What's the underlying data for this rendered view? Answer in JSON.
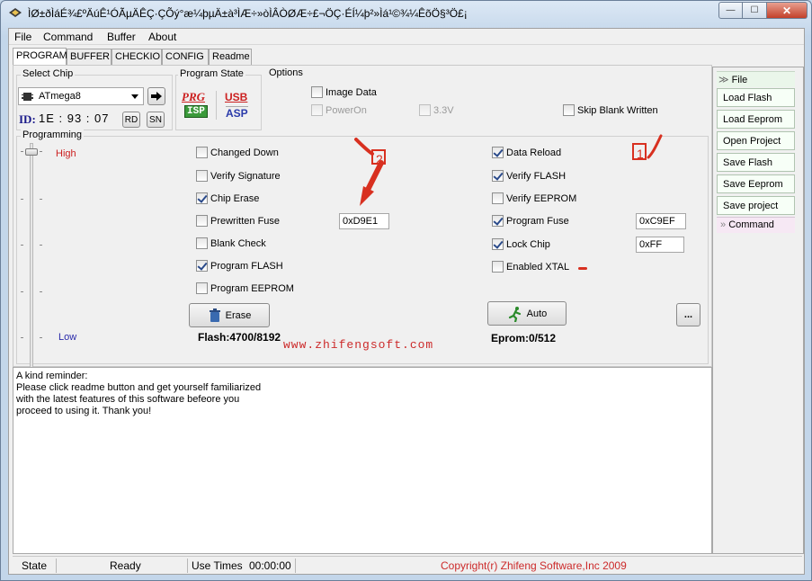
{
  "window": {
    "title": "ÌØ±ðÌáÉ¾£ºÄúÊ¹ÓÃµÄÊÇ·ÇÕý°æ¼þµÄ±à³ÌÆ÷»òÌÂÒØÆ÷£¬ÖÇ·ÉÍ¼þ²»Ìá¹©¾¼ÊõÖ§³Ö£¡",
    "minimize": "—",
    "maximize": "☐",
    "close": "✕"
  },
  "menu": [
    "File",
    "Command",
    "Buffer",
    "About"
  ],
  "tabs": [
    "PROGRAM",
    "BUFFER",
    "CHECKIO",
    "CONFIG",
    "Readme"
  ],
  "select_chip": {
    "label": "Select Chip",
    "value": "ATmega8",
    "id_label": "ID:",
    "id_value": "1E : 93 : 07",
    "rd": "RD",
    "sn": "SN"
  },
  "program_state": {
    "label": "Program State",
    "prg": "PRG",
    "isp": "ISP",
    "usb": "USB",
    "asp": "ASP"
  },
  "options": {
    "label": "Options",
    "image_data": "Image Data",
    "power_on": "PowerOn",
    "v33": "3.3V",
    "skip_blank": "Skip Blank Written"
  },
  "programming": {
    "label": "Programming",
    "high": "High",
    "low": "Low",
    "left_checks": [
      {
        "label": "Changed Down",
        "checked": false
      },
      {
        "label": "Verify Signature",
        "checked": false
      },
      {
        "label": "Chip Erase",
        "checked": true
      },
      {
        "label": "Prewritten Fuse",
        "checked": false
      },
      {
        "label": "Blank Check",
        "checked": false
      },
      {
        "label": "Program FLASH",
        "checked": true
      },
      {
        "label": "Program EEPROM",
        "checked": false
      }
    ],
    "right_checks": [
      {
        "label": "Data Reload",
        "checked": true
      },
      {
        "label": "Verify FLASH",
        "checked": true
      },
      {
        "label": "Verify EEPROM",
        "checked": false
      },
      {
        "label": "Program Fuse",
        "checked": true
      },
      {
        "label": "Lock Chip",
        "checked": true
      },
      {
        "label": "Enabled XTAL",
        "checked": false
      }
    ],
    "prewritten_fuse_value": "0xD9E1",
    "program_fuse_value": "0xC9EF",
    "lock_chip_value": "0xFF",
    "erase": "Erase",
    "auto": "Auto",
    "more": "...",
    "flash": "Flash:4700/8192",
    "eprom": "Eprom:0/512",
    "watermark": "www.zhifengsoft.com",
    "annotation_1": "1",
    "annotation_2": "2"
  },
  "reminder": {
    "lines": [
      "A kind reminder:",
      "Please click readme button and get yourself familiarized",
      "with the latest features of this software befeore you",
      "proceed to using it. Thank you!"
    ]
  },
  "status": {
    "state_label": "State",
    "state_value": "Ready",
    "use_times_label": "Use Times",
    "use_times_value": "00:00:00",
    "copyright": "Copyright(r) Zhifeng Software,Inc 2009"
  },
  "sidebar": {
    "file_header": "File",
    "buttons": [
      "Load Flash",
      "Load Eeprom",
      "Open Project",
      "Save Flash",
      "Save Eeprom",
      "Save project"
    ],
    "command_header": "Command"
  },
  "colors": {
    "accent_red": "#cc2a2a",
    "id_blue": "#1a1a8a"
  }
}
